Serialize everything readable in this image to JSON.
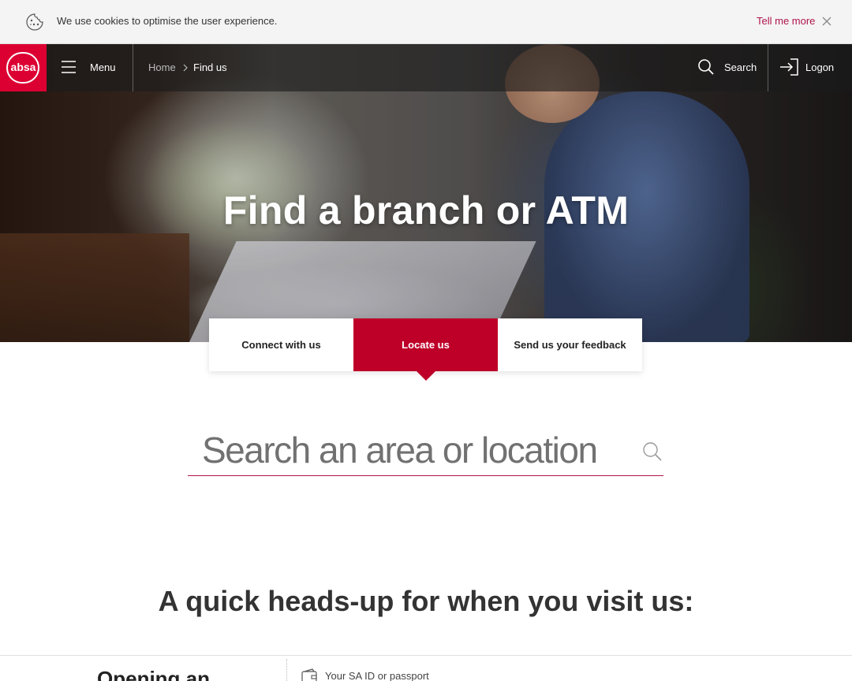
{
  "cookie_bar": {
    "text": "We use cookies to optimise the user experience.",
    "link": "Tell me more",
    "cookie_icon": "cookie-icon",
    "close_icon": "close-icon"
  },
  "nav": {
    "logo_text": "absa",
    "menu_label": "Menu",
    "breadcrumb": {
      "home": "Home",
      "current": "Find us"
    },
    "search_label": "Search",
    "logon_label": "Logon",
    "brand_color": "#dc0032"
  },
  "hero": {
    "title": "Find a branch or ATM"
  },
  "tabs": [
    {
      "label": "Connect with us",
      "active": false
    },
    {
      "label": "Locate us",
      "active": true
    },
    {
      "label": "Send us your feedback",
      "active": false
    }
  ],
  "location_search": {
    "placeholder": "Search an area or location",
    "value": "",
    "underline_color": "#af144b"
  },
  "headsup": {
    "title": "A quick heads-up for when you visit us:",
    "left_heading": "Opening an",
    "first_item": "Your SA ID or passport"
  },
  "colors": {
    "accent": "#be0028",
    "link": "#af144b"
  }
}
